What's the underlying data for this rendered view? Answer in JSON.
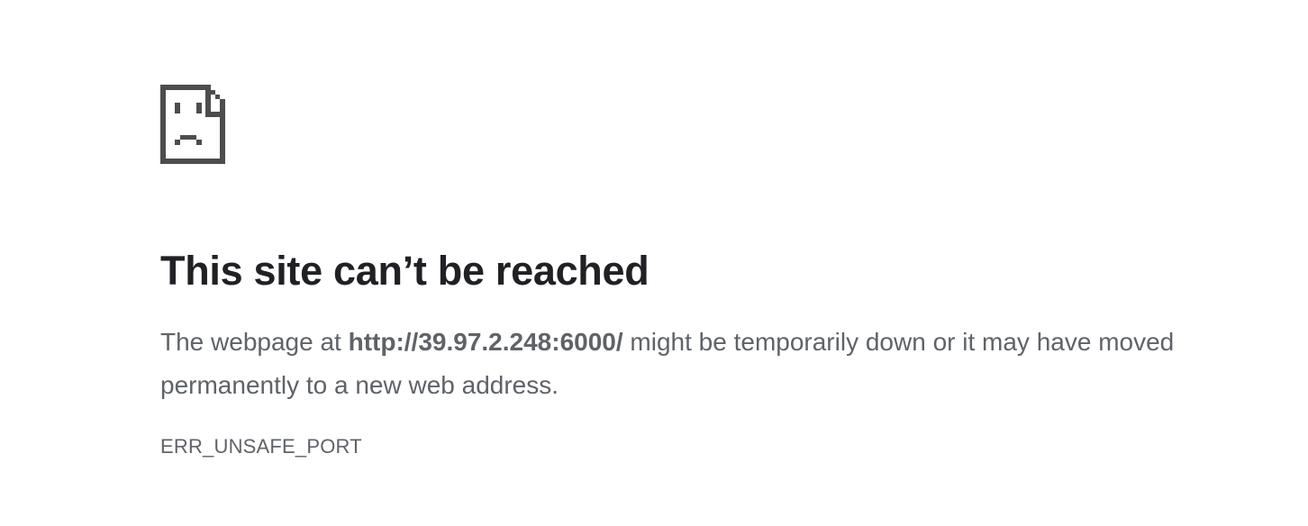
{
  "icon": {
    "name": "sad-document-icon",
    "color": "#4d4d4d"
  },
  "heading": "This site can’t be reached",
  "description": {
    "before": "The webpage at ",
    "url": "http://39.97.2.248:6000/",
    "after": " might be temporarily down or it may have moved permanently to a new web address."
  },
  "error_code": "ERR_UNSAFE_PORT",
  "colors": {
    "heading": "#202124",
    "body_text": "#5f6368",
    "background": "#ffffff"
  }
}
